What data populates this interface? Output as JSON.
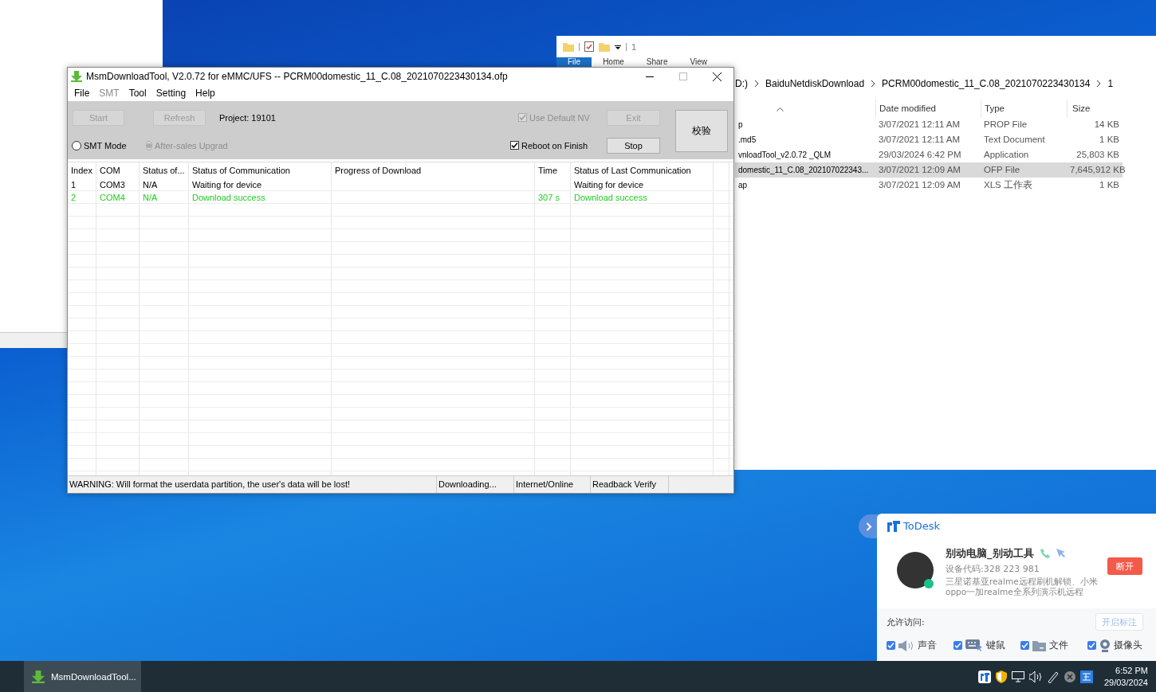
{
  "explorer": {
    "quick_access": "1",
    "ribbon_tabs": [
      {
        "label": "File",
        "selected": true
      },
      {
        "label": "Home",
        "selected": false
      },
      {
        "label": "Share",
        "selected": false
      },
      {
        "label": "View",
        "selected": false
      }
    ],
    "breadcrumb": [
      "D:)",
      "BaiduNetdiskDownload",
      "PCRM00domestic_11_C.08_2021070223430134",
      "1"
    ],
    "columns": [
      "Date modified",
      "Type",
      "Size"
    ],
    "rows": [
      {
        "name": "p",
        "date": "3/07/2021 12:11 AM",
        "type": "PROP File",
        "size": "14 KB",
        "selected": false
      },
      {
        "name": ".md5",
        "date": "3/07/2021 12:11 AM",
        "type": "Text Document",
        "size": "1 KB",
        "selected": false
      },
      {
        "name": "vnloadTool_v2.0.72 _QLM",
        "date": "29/03/2024 6:42 PM",
        "type": "Application",
        "size": "25,803 KB",
        "selected": false
      },
      {
        "name": "domestic_11_C.08_202107022343...",
        "date": "3/07/2021 12:09 AM",
        "type": "OFP File",
        "size": "7,645,912 KB",
        "selected": true
      },
      {
        "name": "ap",
        "date": "3/07/2021 12:09 AM",
        "type": "XLS 工作表",
        "size": "1 KB",
        "selected": false
      }
    ]
  },
  "msm_window": {
    "title": "MsmDownloadTool, V2.0.72 for eMMC/UFS -- PCRM00domestic_11_C.08_2021070223430134.ofp",
    "menu": [
      {
        "label": "File",
        "disabled": false
      },
      {
        "label": "SMT",
        "disabled": true
      },
      {
        "label": "Tool",
        "disabled": false
      },
      {
        "label": "Setting",
        "disabled": false
      },
      {
        "label": "Help",
        "disabled": false
      }
    ],
    "start_button": {
      "label": "Start",
      "disabled": true
    },
    "refresh_button": {
      "label": "Refresh",
      "disabled": true
    },
    "project": "Project:  19101",
    "use_default_nv": {
      "label": "Use Default NV",
      "checked": true,
      "disabled": true
    },
    "exit_button": {
      "label": "Exit",
      "disabled": true
    },
    "modes": [
      {
        "label": "SMT Mode",
        "selected": false,
        "disabled": false
      },
      {
        "label": "After-sales Upgrad",
        "selected": true,
        "disabled": true
      }
    ],
    "reboot_on_finish": {
      "label": "Reboot on Finish",
      "checked": true,
      "disabled": false
    },
    "stop_button": {
      "label": "Stop",
      "disabled": false
    },
    "verify_button": {
      "label": "校验",
      "disabled": false
    },
    "table": {
      "columns": [
        "Index",
        "COM",
        "Status of...",
        "Status of Communication",
        "Progress of Download",
        "Time",
        "Status of Last Communication"
      ],
      "rows": [
        {
          "color": "#000000",
          "cells": [
            "1",
            "COM3",
            "N/A",
            "Waiting for device",
            "",
            "",
            "Waiting for device"
          ]
        },
        {
          "color": "#22cc22",
          "cells": [
            "2",
            "COM4",
            "N/A",
            "Download success",
            "",
            "307 s",
            "Download success"
          ]
        }
      ]
    },
    "status_bar": [
      "WARNING: Will format the userdata partition, the user's data will be lost!",
      "Downloading...",
      "Internet/Online",
      "Readback Verify"
    ]
  },
  "todesk": {
    "title": "ToDesk",
    "name": "别动电脑_别动工具",
    "device_code": "设备代码:328 223 981",
    "description": "三星诺基亚realme远程刷机解锁、小米oppo一加realme全系列演示机远程",
    "disconnect_button": "断开",
    "access_label": "允许访问:",
    "annotate_button": "开启标注",
    "permissions": [
      {
        "label": "声音",
        "kind": "sound",
        "checked": true
      },
      {
        "label": "键鼠",
        "kind": "keyboard",
        "checked": true
      },
      {
        "label": "文件",
        "kind": "folder",
        "checked": true
      },
      {
        "label": "摄像头",
        "kind": "camera",
        "checked": true
      }
    ]
  },
  "taskbar": {
    "app": "MsmDownloadTool...",
    "time": "6:52 PM",
    "date": "29/03/2024"
  }
}
